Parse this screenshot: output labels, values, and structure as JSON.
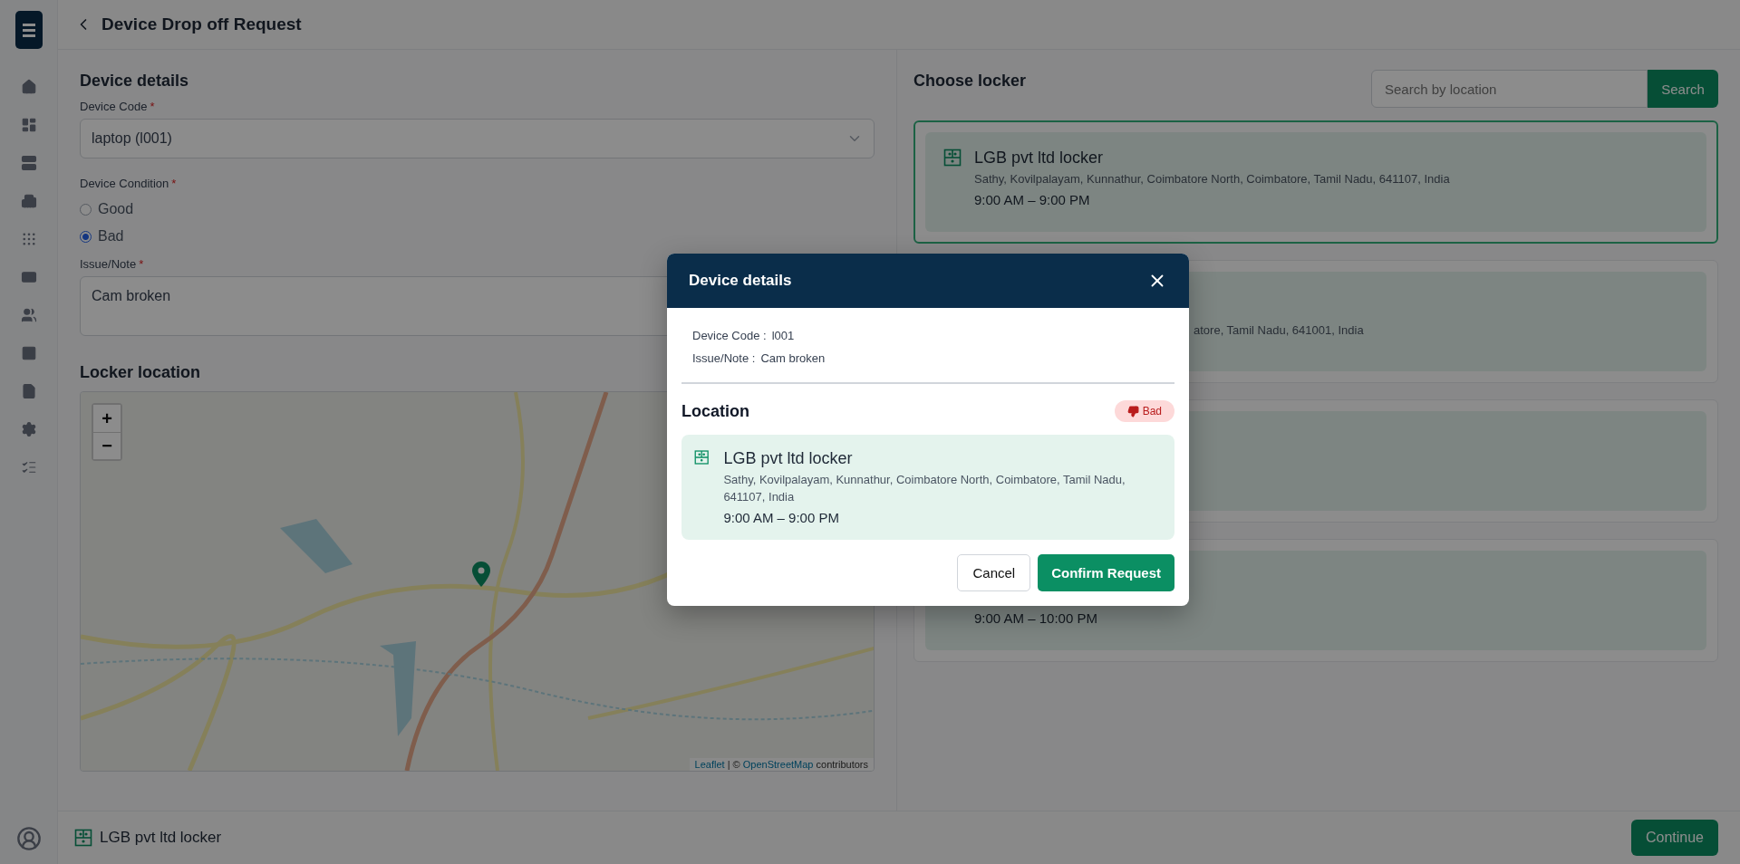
{
  "header": {
    "title": "Device Drop off Request"
  },
  "device_details": {
    "heading": "Device details",
    "device_code": {
      "label": "Device Code",
      "required_mark": "*",
      "value": "laptop (l001)"
    },
    "condition": {
      "label": "Device Condition",
      "required_mark": "*",
      "options": [
        {
          "label": "Good",
          "selected": false
        },
        {
          "label": "Bad",
          "selected": true
        }
      ]
    },
    "issue": {
      "label": "Issue/Note",
      "required_mark": "*",
      "value": "Cam broken"
    }
  },
  "locker_location": {
    "heading": "Locker location",
    "map": {
      "zoom_in": "+",
      "zoom_out": "−",
      "link_1": "Leaflet",
      "separator": "| ©",
      "link_2": "OpenStreetMap",
      "tail": "contributors"
    }
  },
  "choose_locker": {
    "heading": "Choose locker",
    "search": {
      "placeholder": "Search by location",
      "button": "Search"
    },
    "lockers": [
      {
        "selected": true,
        "name": "LGB pvt ltd locker",
        "address": "Sathy, Kovilpalayam, Kunnathur, Coimbatore North, Coimbatore, Tamil Nadu, 641107, India",
        "hours": "9:00 AM – 9:00 PM"
      },
      {
        "selected": false,
        "address": "atore, Tamil Nadu, 641001, India"
      },
      {
        "selected": false
      },
      {
        "selected": false,
        "hours": "9:00 AM – 10:00 PM"
      }
    ]
  },
  "footer": {
    "locker_name": "LGB pvt ltd locker",
    "button": "Continue"
  },
  "modal": {
    "title": "Device details",
    "details": [
      {
        "label": "Device Code :",
        "value": "l001"
      },
      {
        "label": "Issue/Note :",
        "value": "Cam broken"
      }
    ],
    "section": "Location",
    "condition": {
      "kind": "bad",
      "label": "Bad"
    },
    "locker": {
      "name": "LGB pvt ltd locker",
      "address": "Sathy, Kovilpalayam, Kunnathur, Coimbatore North, Coimbatore, Tamil Nadu, 641107, India",
      "hours": "9:00 AM – 9:00 PM"
    },
    "cancel": "Cancel",
    "confirm": "Confirm Request"
  }
}
